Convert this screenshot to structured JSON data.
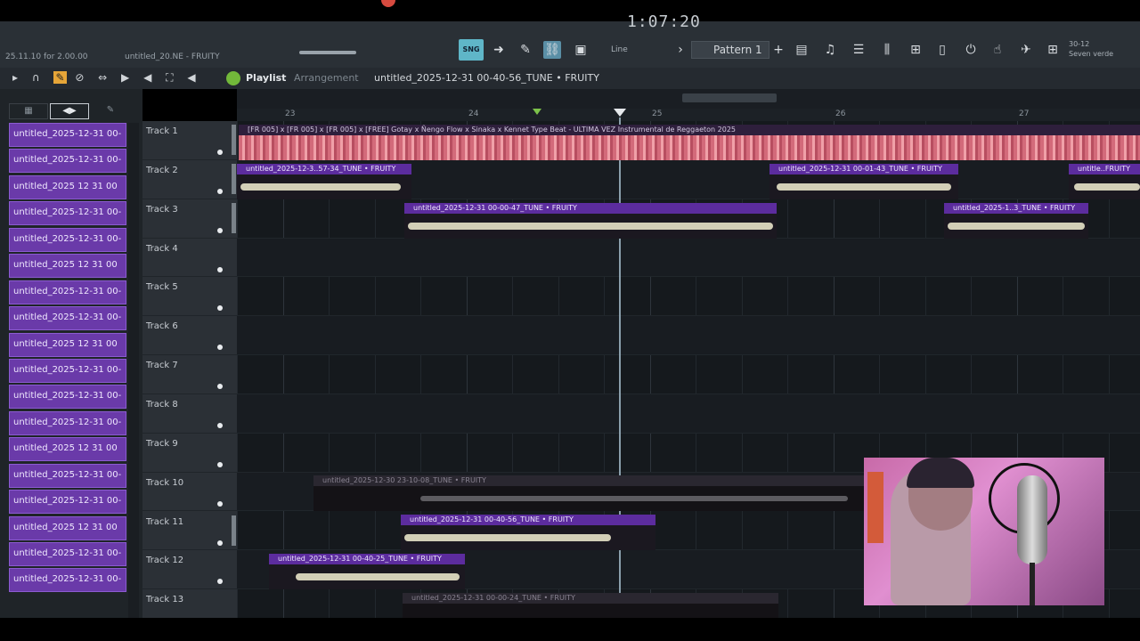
{
  "toolbar": {
    "hint": "25.11.10 for 2.00.00",
    "project_name": "untitled_20.NE - FRUITY",
    "time": "1:07:20",
    "mode_label": "SNG",
    "snap": "Line",
    "pattern": "Pattern 1",
    "cpu_line1": "30-12",
    "cpu_line2": "Seven verde"
  },
  "playlist": {
    "title": "Playlist",
    "subtitle": "Arrangement",
    "path": "untitled_2025-12-31 00-40-56_TUNE • FRUITY"
  },
  "picker": {
    "items": [
      "untitled_2025-12-31 00-",
      "untitled_2025-12-31 00-",
      "untitled_2025 12 31 00",
      "untitled_2025-12-31 00-",
      "untitled_2025-12-31 00-",
      "untitled_2025 12 31 00",
      "untitled_2025-12-31 00-",
      "untitled_2025-12-31 00-",
      "untitled_2025 12 31 00",
      "untitled_2025-12-31 00-",
      "untitled_2025-12-31 00-",
      "untitled_2025-12-31 00-",
      "untitled_2025 12 31 00",
      "untitled_2025-12-31 00-",
      "untitled_2025-12-31 00-",
      "untitled_2025 12 31 00",
      "untitled_2025-12-31 00-",
      "untitled_2025-12-31 00-"
    ]
  },
  "ruler": {
    "labels": [
      "23",
      "24",
      "25",
      "26",
      "27"
    ]
  },
  "tracks": [
    {
      "name": "Track 1"
    },
    {
      "name": "Track 2"
    },
    {
      "name": "Track 3"
    },
    {
      "name": "Track 4"
    },
    {
      "name": "Track 5"
    },
    {
      "name": "Track 6"
    },
    {
      "name": "Track 7"
    },
    {
      "name": "Track 8"
    },
    {
      "name": "Track 9"
    },
    {
      "name": "Track 10"
    },
    {
      "name": "Track 11"
    },
    {
      "name": "Track 12"
    },
    {
      "name": "Track 13"
    }
  ],
  "clips": {
    "master": "[FR 005] x [FR 005] x [FR 005] x [FREE] Gotay x Ñengo Flow x Sinaka x Kennet Type Beat - ULTIMA VEZ Instrumental de Reggaeton 2025",
    "t2a": "untitled_2025-12-3..57-34_TUNE • FRUITY",
    "t2b": "untitled_2025-12-31 00-01-43_TUNE • FRUITY",
    "t2c": "untitle..FRUITY",
    "t3a": "untitled_2025-12-31 00-00-47_TUNE • FRUITY",
    "t3b": "untitled_2025-1..3_TUNE • FRUITY",
    "t10": "untitled_2025-12-30 23-10-08_TUNE • FRUITY",
    "t11": "untitled_2025-12-31 00-40-56_TUNE • FRUITY",
    "t12": "untitled_2025-12-31 00-40-25_TUNE • FRUITY",
    "t13": "untitled_2025-12-31 00-00-24_TUNE • FRUITY"
  },
  "colors": {
    "clip_header": "#5c2c9e",
    "picker_item": "#6a3aa9",
    "master_wave": "#d36a7a"
  }
}
